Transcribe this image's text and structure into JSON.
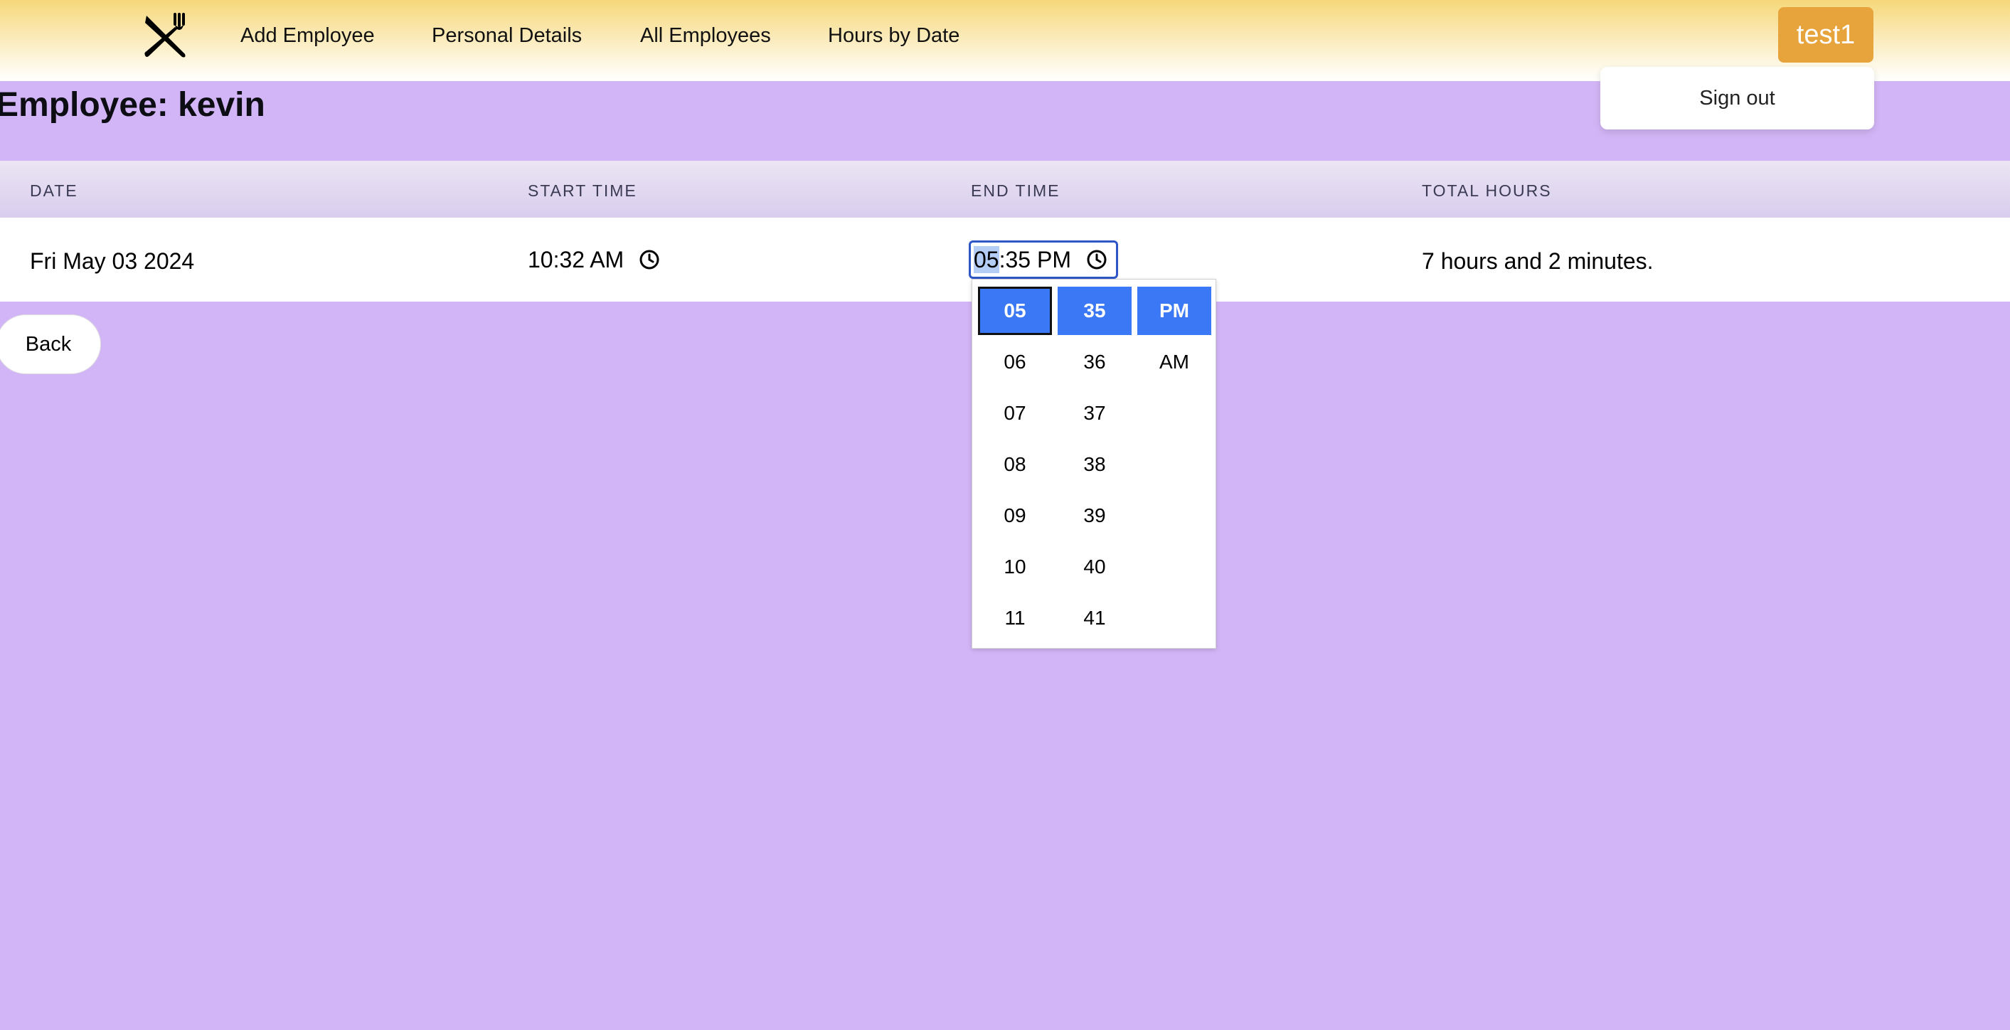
{
  "nav": {
    "links": [
      "Add Employee",
      "Personal Details",
      "All Employees",
      "Hours by Date"
    ],
    "user_label": "test1",
    "signout_label": "Sign out"
  },
  "page": {
    "title": "Employee: kevin",
    "back_label": "Back"
  },
  "table": {
    "headers": [
      "DATE",
      "START TIME",
      "END TIME",
      "TOTAL HOURS"
    ],
    "row": {
      "date": "Fri May 03 2024",
      "start_time": "10:32 AM",
      "end_time_hour": "05",
      "end_time_rest": ":35 PM",
      "total_hours": "7 hours and 2 minutes."
    }
  },
  "time_picker": {
    "hours": [
      "05",
      "06",
      "07",
      "08",
      "09",
      "10",
      "11"
    ],
    "minutes": [
      "35",
      "36",
      "37",
      "38",
      "39",
      "40",
      "41"
    ],
    "periods": [
      "PM",
      "AM"
    ],
    "selected": {
      "hour": "05",
      "minute": "35",
      "period": "PM"
    }
  },
  "colors": {
    "background": "#d2b5f6",
    "user_button": "#e8a43c",
    "picker_selected": "#3b78f5"
  },
  "icons": [
    "fork-knife-logo-icon",
    "clock-icon"
  ]
}
